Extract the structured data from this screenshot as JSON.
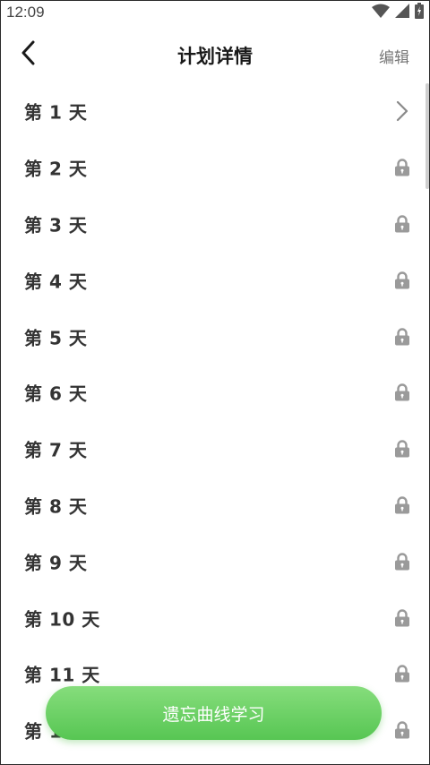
{
  "status_bar": {
    "time": "12:09"
  },
  "header": {
    "title": "计划详情",
    "edit_label": "编辑"
  },
  "days": [
    {
      "label": "第 1 天",
      "state": "unlocked",
      "icon": "chevron-right-icon"
    },
    {
      "label": "第 2 天",
      "state": "locked",
      "icon": "lock-icon"
    },
    {
      "label": "第 3 天",
      "state": "locked",
      "icon": "lock-icon"
    },
    {
      "label": "第 4 天",
      "state": "locked",
      "icon": "lock-icon"
    },
    {
      "label": "第 5 天",
      "state": "locked",
      "icon": "lock-icon"
    },
    {
      "label": "第 6 天",
      "state": "locked",
      "icon": "lock-icon"
    },
    {
      "label": "第 7 天",
      "state": "locked",
      "icon": "lock-icon"
    },
    {
      "label": "第 8 天",
      "state": "locked",
      "icon": "lock-icon"
    },
    {
      "label": "第 9 天",
      "state": "locked",
      "icon": "lock-icon"
    },
    {
      "label": "第 10 天",
      "state": "locked",
      "icon": "lock-icon"
    },
    {
      "label": "第 11 天",
      "state": "locked",
      "icon": "lock-icon"
    },
    {
      "label": "第 12 天",
      "state": "locked",
      "icon": "lock-icon"
    }
  ],
  "study_button": {
    "label": "遗忘曲线学习"
  },
  "colors": {
    "button_gradient_top": "#86dd7c",
    "button_gradient_bottom": "#57c653",
    "lock_icon": "#9a9a9a",
    "title": "#1a1a1a"
  }
}
